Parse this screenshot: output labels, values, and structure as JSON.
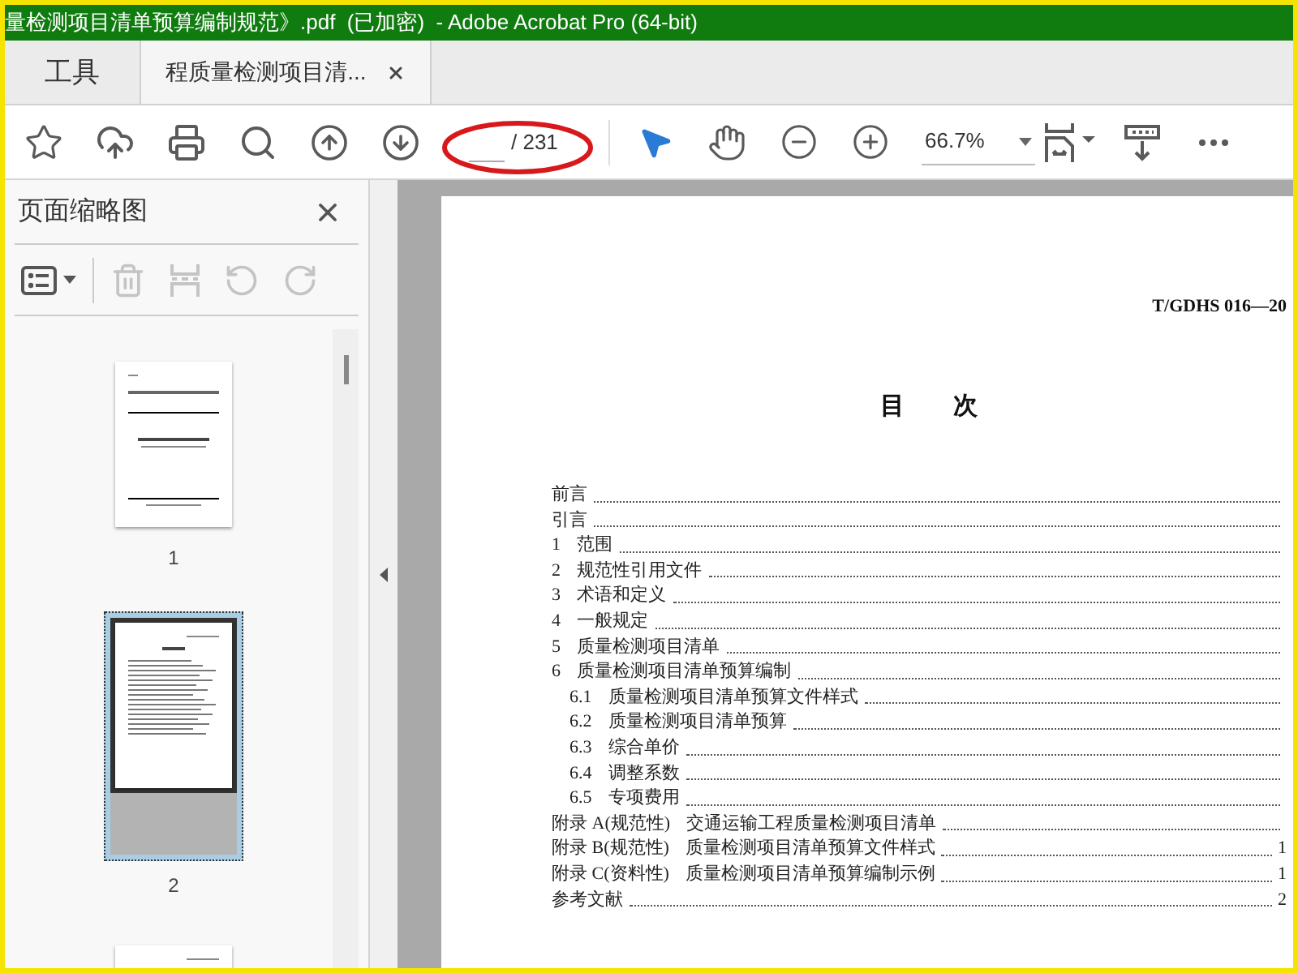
{
  "window": {
    "title": "量检测项目清单预算编制规范》.pdf  (已加密)  - Adobe Acrobat Pro (64-bit)"
  },
  "tabs": [
    {
      "label": "工具",
      "selected": false,
      "closable": false
    },
    {
      "label": "程质量检测项目清...",
      "selected": true,
      "closable": true
    }
  ],
  "toolbar": {
    "page_total": "/ 231",
    "zoom": "66.7%"
  },
  "sidebar": {
    "title": "页面缩略图",
    "tools": [
      {
        "kind": "options",
        "disabled": false
      },
      {
        "kind": "delete",
        "disabled": true
      },
      {
        "kind": "insert",
        "disabled": true
      },
      {
        "kind": "undo",
        "disabled": true
      },
      {
        "kind": "redo",
        "disabled": true
      }
    ],
    "thumbnails": [
      {
        "kind": "cover",
        "label": "1",
        "selected": false
      },
      {
        "kind": "toc",
        "label": "2",
        "selected": true
      },
      {
        "kind": "text",
        "selected": false
      }
    ]
  },
  "document": {
    "header": "T/GDHS 016—20",
    "heading": "目　　次",
    "toc": [
      {
        "title": "前言"
      },
      {
        "title": "引言"
      },
      {
        "number": "1",
        "title": "范围"
      },
      {
        "number": "2",
        "title": "规范性引用文件"
      },
      {
        "number": "3",
        "title": "术语和定义"
      },
      {
        "number": "4",
        "title": "一般规定"
      },
      {
        "number": "5",
        "title": "质量检测项目清单"
      },
      {
        "number": "6",
        "title": "质量检测项目清单预算编制",
        "children": [
          {
            "number": "6.1",
            "title": "质量检测项目清单预算文件样式"
          },
          {
            "number": "6.2",
            "title": "质量检测项目清单预算"
          },
          {
            "number": "6.3",
            "title": "综合单价"
          },
          {
            "number": "6.4",
            "title": "调整系数"
          },
          {
            "number": "6.5",
            "title": "专项费用"
          }
        ]
      },
      {
        "number": "附录 A(规范性)",
        "title": "交通运输工程质量检测项目清单"
      },
      {
        "number": "附录 B(规范性)",
        "title": "质量检测项目清单预算文件样式",
        "page": "1"
      },
      {
        "number": "附录 C(资料性)",
        "title": "质量检测项目清单预算编制示例",
        "page": "1"
      },
      {
        "title": "参考文献",
        "page": "2"
      }
    ]
  }
}
